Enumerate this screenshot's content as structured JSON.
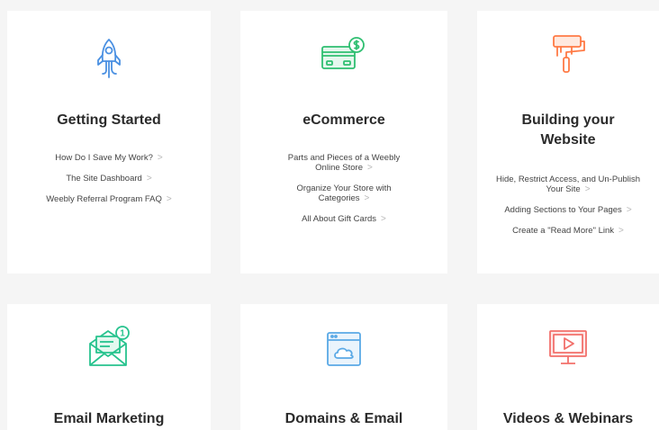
{
  "cards": [
    {
      "title": "Getting Started",
      "icon": "rocket-icon",
      "links": [
        {
          "label": "How Do I Save My Work?"
        },
        {
          "label": "The Site Dashboard"
        },
        {
          "label": "Weebly Referral Program FAQ"
        }
      ]
    },
    {
      "title": "eCommerce",
      "icon": "credit-card-icon",
      "links": [
        {
          "label": "Parts and Pieces of a Weebly Online Store"
        },
        {
          "label": "Organize Your Store with Categories"
        },
        {
          "label": "All About Gift Cards"
        }
      ]
    },
    {
      "title": "Building your Website",
      "icon": "paint-roller-icon",
      "links": [
        {
          "label": "Hide, Restrict Access, and Un-Publish Your Site"
        },
        {
          "label": "Adding Sections to Your Pages"
        },
        {
          "label": "Create a \"Read More\" Link"
        }
      ]
    },
    {
      "title": "Email Marketing",
      "icon": "envelope-icon",
      "badge": "1"
    },
    {
      "title": "Domains & Email",
      "icon": "browser-cloud-icon"
    },
    {
      "title": "Videos & Webinars",
      "icon": "video-monitor-icon"
    }
  ],
  "chevron": ">",
  "colors": {
    "blue": "#4a90e2",
    "green": "#2fbf71",
    "orange": "#ff7a45",
    "teal": "#27c38e",
    "skyblue": "#5aa9e6",
    "red": "#f2706b"
  }
}
